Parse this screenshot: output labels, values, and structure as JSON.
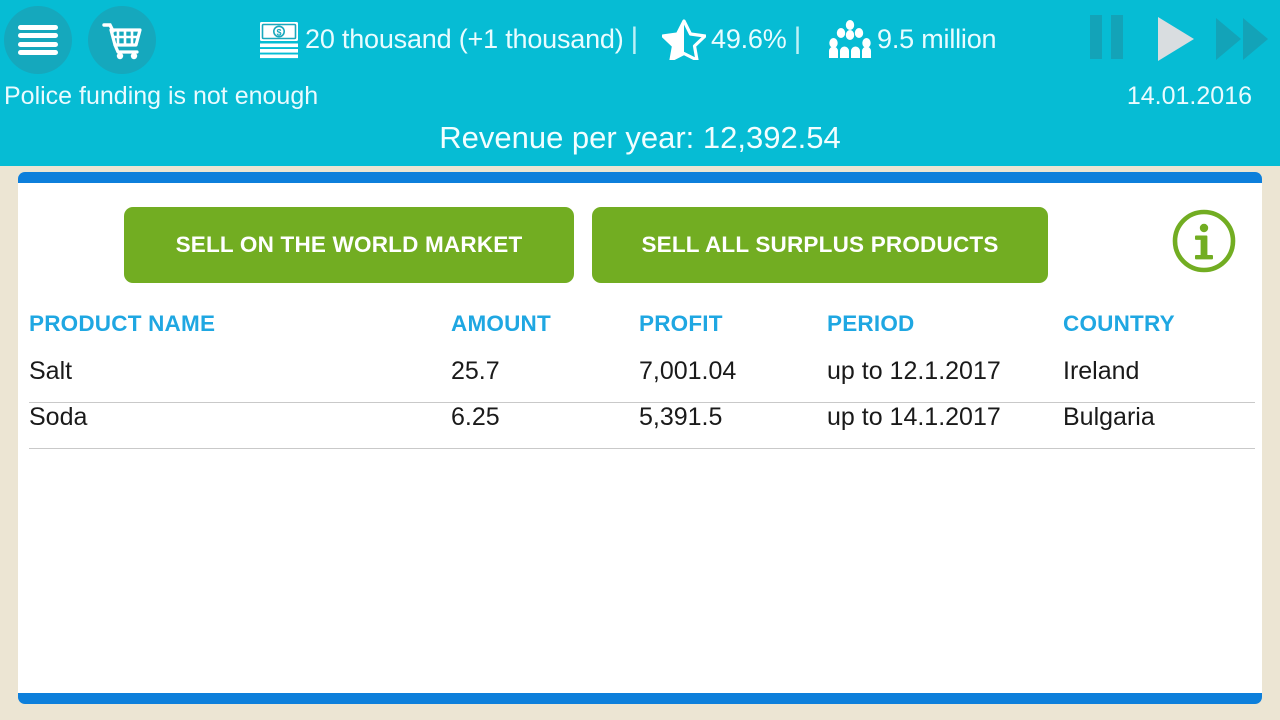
{
  "topbar": {
    "menu_icon": "hamburger-menu-icon",
    "cart_icon": "shopping-cart-icon",
    "stats": {
      "money_icon": "money-banknote-icon",
      "money_value": "20 thousand (+1 thousand)",
      "approval_icon": "half-star-icon",
      "approval_value": "49.6%",
      "population_icon": "people-group-icon",
      "population_value": "9.5 million",
      "separator": "|"
    },
    "playback": {
      "pause_icon": "pause-icon",
      "play_icon": "play-icon",
      "fast_forward_icon": "fast-forward-icon"
    },
    "alert_message": "Police funding is not enough",
    "date": "14.01.2016",
    "revenue_line": "Revenue per year: 12,392.54"
  },
  "panel": {
    "sell_world_label": "SELL ON THE WORLD MARKET",
    "sell_surplus_label": "SELL ALL SURPLUS PRODUCTS",
    "info_icon": "info-circle-icon",
    "table": {
      "columns": [
        "PRODUCT NAME",
        "AMOUNT",
        "PROFIT",
        "PERIOD",
        "COUNTRY"
      ],
      "rows": [
        {
          "name": "Salt",
          "amount": "25.7",
          "profit": "7,001.04",
          "period": "up to 12.1.2017",
          "country": "Ireland"
        },
        {
          "name": "Soda",
          "amount": "6.25",
          "profit": "5,391.5",
          "period": "up to 14.1.2017",
          "country": "Bulgaria"
        }
      ]
    }
  },
  "colors": {
    "header_cyan": "#06bcd4",
    "panel_blue": "#0d7fdb",
    "button_green": "#72ad22",
    "column_header_blue": "#1fa7e2",
    "page_background": "#ece5d3"
  }
}
